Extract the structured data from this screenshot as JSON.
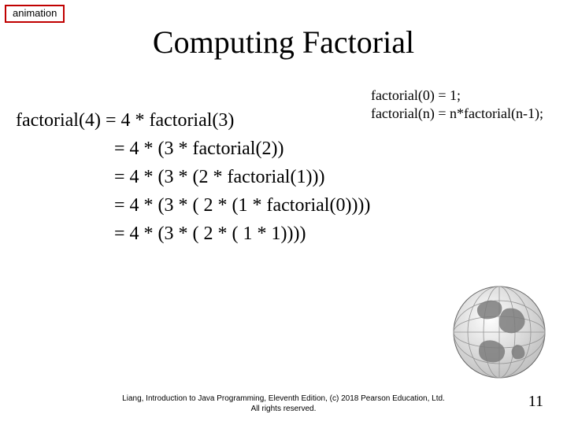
{
  "badge": {
    "label": "animation"
  },
  "title": "Computing Factorial",
  "defs": {
    "line1": "factorial(0) = 1;",
    "line2": "factorial(n) = n*factorial(n-1);"
  },
  "expansion": {
    "lhs": "factorial(4) ",
    "rows": [
      "= 4 * factorial(3)",
      "= 4 * (3 * factorial(2))",
      "= 4 * (3 * (2 * factorial(1)))",
      "= 4 * (3 * ( 2 * (1 * factorial(0))))",
      "= 4 * (3 * ( 2 * ( 1 * 1))))"
    ]
  },
  "footer": {
    "line1": "Liang, Introduction to Java Programming, Eleventh Edition, (c) 2018 Pearson Education, Ltd.",
    "line2": "All rights reserved."
  },
  "page_number": "11"
}
